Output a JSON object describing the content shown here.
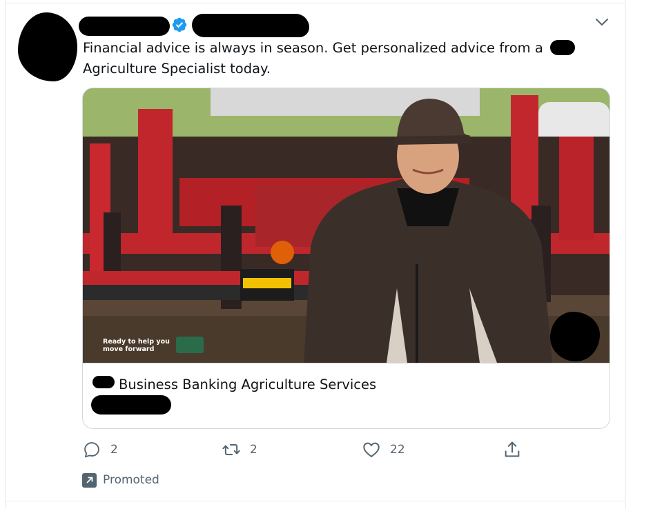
{
  "tweet": {
    "text_line1": "Financial advice is always in season. Get personalized advice from a",
    "text_line2": "Agriculture Specialist today.",
    "verified_color": "#1d9bf0"
  },
  "card": {
    "title": "Business Banking Agriculture Services",
    "image_overlay_line1": "Ready to help you",
    "image_overlay_line2": "move forward"
  },
  "actions": {
    "reply_count": "2",
    "retweet_count": "2",
    "like_count": "22"
  },
  "promoted": {
    "label": "Promoted"
  },
  "icons": [
    "verified-badge-icon",
    "chevron-down-icon",
    "reply-icon",
    "retweet-icon",
    "like-icon",
    "share-icon",
    "promoted-arrow-icon"
  ],
  "colors": {
    "text": "#0f1419",
    "secondary": "#536471",
    "border": "#cfd9de"
  }
}
